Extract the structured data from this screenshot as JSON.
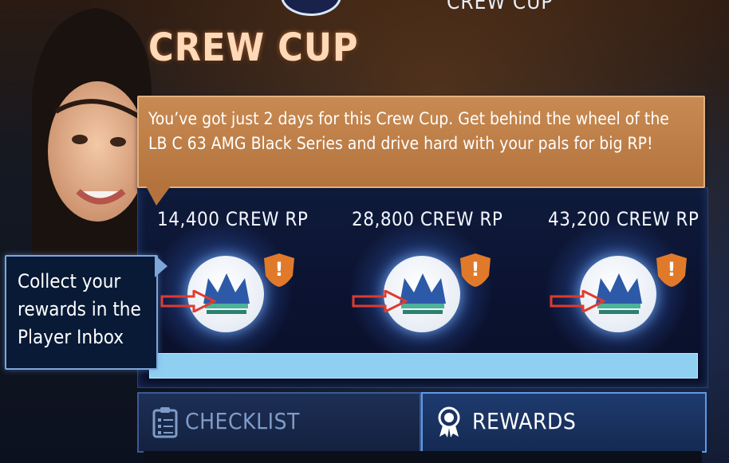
{
  "header": {
    "top_label": "CREW CUP",
    "title": "CREW CUP"
  },
  "message": {
    "text": "You’ve got just 2 days for this Crew Cup. Get behind the wheel of the LB C 63 AMG Black Series and drive hard with your pals for big RP!"
  },
  "tiers": [
    {
      "label": "14,400 CREW RP",
      "icon": "crown-medal-icon",
      "badge": "!"
    },
    {
      "label": "28,800 CREW RP",
      "icon": "crown-medal-icon",
      "badge": "!"
    },
    {
      "label": "43,200 CREW RP",
      "icon": "crown-medal-icon",
      "badge": "!"
    }
  ],
  "progress": {
    "fraction": 1.0
  },
  "tooltip": {
    "text": "Collect your rewards in the Player Inbox"
  },
  "tabs": {
    "checklist": {
      "label": "CHECKLIST",
      "icon": "clipboard-icon"
    },
    "rewards": {
      "label": "REWARDS",
      "icon": "award-ribbon-icon"
    }
  },
  "colors": {
    "title": "#ffd9b8",
    "bubble": "#b4733d",
    "progress": "#8fd0f2",
    "badge": "#e07a2a",
    "arrow": "#e03a2e"
  }
}
